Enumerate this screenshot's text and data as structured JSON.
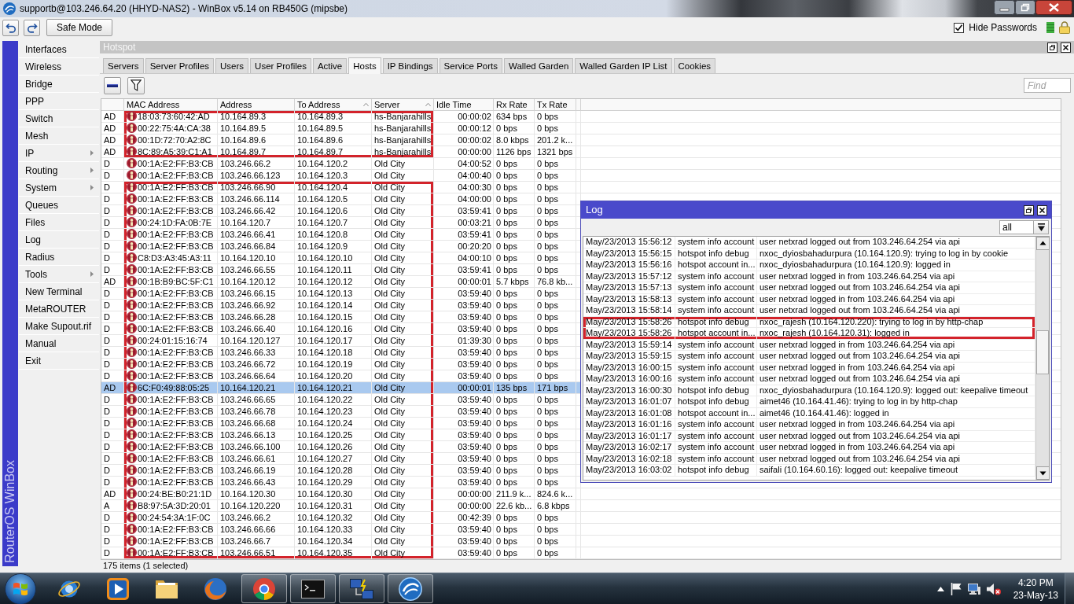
{
  "window": {
    "title": "supportb@103.246.64.20 (HHYD-NAS2) - WinBox v5.14 on RB450G (mipsbe)"
  },
  "toolbar": {
    "safe_mode": {
      "label": "Safe Mode"
    },
    "hide_passwords": {
      "label": "Hide Passwords",
      "checked": true
    }
  },
  "sidebar": {
    "brand": "RouterOS WinBox",
    "items": [
      {
        "label": "Interfaces",
        "submenu": false
      },
      {
        "label": "Wireless",
        "submenu": false
      },
      {
        "label": "Bridge",
        "submenu": false
      },
      {
        "label": "PPP",
        "submenu": false
      },
      {
        "label": "Switch",
        "submenu": false
      },
      {
        "label": "Mesh",
        "submenu": false
      },
      {
        "label": "IP",
        "submenu": true
      },
      {
        "label": "Routing",
        "submenu": true
      },
      {
        "label": "System",
        "submenu": true
      },
      {
        "label": "Queues",
        "submenu": false
      },
      {
        "label": "Files",
        "submenu": false
      },
      {
        "label": "Log",
        "submenu": false
      },
      {
        "label": "Radius",
        "submenu": false
      },
      {
        "label": "Tools",
        "submenu": true
      },
      {
        "label": "New Terminal",
        "submenu": false
      },
      {
        "label": "MetaROUTER",
        "submenu": false
      },
      {
        "label": "Make Supout.rif",
        "submenu": false
      },
      {
        "label": "Manual",
        "submenu": false
      },
      {
        "label": "Exit",
        "submenu": false
      }
    ]
  },
  "hotspot": {
    "title": "Hotspot",
    "tabs": [
      {
        "label": "Servers",
        "selected": false
      },
      {
        "label": "Server Profiles",
        "selected": false
      },
      {
        "label": "Users",
        "selected": false
      },
      {
        "label": "User Profiles",
        "selected": false
      },
      {
        "label": "Active",
        "selected": false
      },
      {
        "label": "Hosts",
        "selected": true
      },
      {
        "label": "IP Bindings",
        "selected": false
      },
      {
        "label": "Service Ports",
        "selected": false
      },
      {
        "label": "Walled Garden",
        "selected": false
      },
      {
        "label": "Walled Garden IP List",
        "selected": false
      },
      {
        "label": "Cookies",
        "selected": false
      }
    ],
    "find": {
      "placeholder": "Find"
    },
    "columns": [
      {
        "label": "MAC Address",
        "sorted": false
      },
      {
        "label": "Address",
        "sorted": false
      },
      {
        "label": "To Address",
        "sorted": true
      },
      {
        "label": "Server",
        "sorted": true
      },
      {
        "label": "Idle Time",
        "sorted": false
      },
      {
        "label": "Rx Rate",
        "sorted": false
      },
      {
        "label": "Tx Rate",
        "sorted": false
      }
    ],
    "rows": [
      {
        "column_1": "AD",
        "mac_address": "18:03:73:60:42:AD",
        "address": "10.164.89.3",
        "to_address": "10.164.89.3",
        "server": "hs-Banjarahills",
        "idle_time": "00:00:02",
        "rx_rate": "634 bps",
        "tx_rate": "0 bps",
        "selected": false,
        "outlined": true
      },
      {
        "column_1": "AD",
        "mac_address": "00:22:75:4A:CA:38",
        "address": "10.164.89.5",
        "to_address": "10.164.89.5",
        "server": "hs-Banjarahills",
        "idle_time": "00:00:12",
        "rx_rate": "0 bps",
        "tx_rate": "0 bps",
        "selected": false,
        "outlined": true
      },
      {
        "column_1": "AD",
        "mac_address": "00:1D:72:70:A2:8C",
        "address": "10.164.89.6",
        "to_address": "10.164.89.6",
        "server": "hs-Banjarahills",
        "idle_time": "00:00:02",
        "rx_rate": "8.0 kbps",
        "tx_rate": "201.2 k...",
        "selected": false,
        "outlined": true
      },
      {
        "column_1": "AD",
        "mac_address": "8C:89:A5:39:C1:A1",
        "address": "10.164.89.7",
        "to_address": "10.164.89.7",
        "server": "hs-Banjarahills",
        "idle_time": "00:00:00",
        "rx_rate": "1126 bps",
        "tx_rate": "1321 bps",
        "selected": false,
        "outlined": true
      },
      {
        "column_1": "D",
        "mac_address": "00:1A:E2:FF:B3:CB",
        "address": "103.246.66.2",
        "to_address": "10.164.120.2",
        "server": "Old City",
        "idle_time": "04:00:52",
        "rx_rate": "0 bps",
        "tx_rate": "0 bps",
        "selected": false,
        "outlined": false
      },
      {
        "column_1": "D",
        "mac_address": "00:1A:E2:FF:B3:CB",
        "address": "103.246.66.123",
        "to_address": "10.164.120.3",
        "server": "Old City",
        "idle_time": "04:00:40",
        "rx_rate": "0 bps",
        "tx_rate": "0 bps",
        "selected": false,
        "outlined": false
      },
      {
        "column_1": "D",
        "mac_address": "00:1A:E2:FF:B3:CB",
        "address": "103.246.66.90",
        "to_address": "10.164.120.4",
        "server": "Old City",
        "idle_time": "04:00:30",
        "rx_rate": "0 bps",
        "tx_rate": "0 bps",
        "selected": false,
        "outlined": true
      },
      {
        "column_1": "D",
        "mac_address": "00:1A:E2:FF:B3:CB",
        "address": "103.246.66.114",
        "to_address": "10.164.120.5",
        "server": "Old City",
        "idle_time": "04:00:00",
        "rx_rate": "0 bps",
        "tx_rate": "0 bps",
        "selected": false,
        "outlined": true
      },
      {
        "column_1": "D",
        "mac_address": "00:1A:E2:FF:B3:CB",
        "address": "103.246.66.42",
        "to_address": "10.164.120.6",
        "server": "Old City",
        "idle_time": "03:59:41",
        "rx_rate": "0 bps",
        "tx_rate": "0 bps",
        "selected": false,
        "outlined": true
      },
      {
        "column_1": "D",
        "mac_address": "00:24:1D:FA:0B:7E",
        "address": "10.164.120.7",
        "to_address": "10.164.120.7",
        "server": "Old City",
        "idle_time": "00:03:21",
        "rx_rate": "0 bps",
        "tx_rate": "0 bps",
        "selected": false,
        "outlined": true
      },
      {
        "column_1": "D",
        "mac_address": "00:1A:E2:FF:B3:CB",
        "address": "103.246.66.41",
        "to_address": "10.164.120.8",
        "server": "Old City",
        "idle_time": "03:59:41",
        "rx_rate": "0 bps",
        "tx_rate": "0 bps",
        "selected": false,
        "outlined": true
      },
      {
        "column_1": "D",
        "mac_address": "00:1A:E2:FF:B3:CB",
        "address": "103.246.66.84",
        "to_address": "10.164.120.9",
        "server": "Old City",
        "idle_time": "00:20:20",
        "rx_rate": "0 bps",
        "tx_rate": "0 bps",
        "selected": false,
        "outlined": true
      },
      {
        "column_1": "D",
        "mac_address": "C8:D3:A3:45:A3:11",
        "address": "10.164.120.10",
        "to_address": "10.164.120.10",
        "server": "Old City",
        "idle_time": "04:00:10",
        "rx_rate": "0 bps",
        "tx_rate": "0 bps",
        "selected": false,
        "outlined": true
      },
      {
        "column_1": "D",
        "mac_address": "00:1A:E2:FF:B3:CB",
        "address": "103.246.66.55",
        "to_address": "10.164.120.11",
        "server": "Old City",
        "idle_time": "03:59:41",
        "rx_rate": "0 bps",
        "tx_rate": "0 bps",
        "selected": false,
        "outlined": true
      },
      {
        "column_1": "AD",
        "mac_address": "00:1B:B9:BC:5F:C1",
        "address": "10.164.120.12",
        "to_address": "10.164.120.12",
        "server": "Old City",
        "idle_time": "00:00:01",
        "rx_rate": "5.7 kbps",
        "tx_rate": "76.8 kb...",
        "selected": false,
        "outlined": true
      },
      {
        "column_1": "D",
        "mac_address": "00:1A:E2:FF:B3:CB",
        "address": "103.246.66.15",
        "to_address": "10.164.120.13",
        "server": "Old City",
        "idle_time": "03:59:40",
        "rx_rate": "0 bps",
        "tx_rate": "0 bps",
        "selected": false,
        "outlined": true
      },
      {
        "column_1": "D",
        "mac_address": "00:1A:E2:FF:B3:CB",
        "address": "103.246.66.92",
        "to_address": "10.164.120.14",
        "server": "Old City",
        "idle_time": "03:59:40",
        "rx_rate": "0 bps",
        "tx_rate": "0 bps",
        "selected": false,
        "outlined": true
      },
      {
        "column_1": "D",
        "mac_address": "00:1A:E2:FF:B3:CB",
        "address": "103.246.66.28",
        "to_address": "10.164.120.15",
        "server": "Old City",
        "idle_time": "03:59:40",
        "rx_rate": "0 bps",
        "tx_rate": "0 bps",
        "selected": false,
        "outlined": true
      },
      {
        "column_1": "D",
        "mac_address": "00:1A:E2:FF:B3:CB",
        "address": "103.246.66.40",
        "to_address": "10.164.120.16",
        "server": "Old City",
        "idle_time": "03:59:40",
        "rx_rate": "0 bps",
        "tx_rate": "0 bps",
        "selected": false,
        "outlined": true
      },
      {
        "column_1": "D",
        "mac_address": "00:24:01:15:16:74",
        "address": "10.164.120.127",
        "to_address": "10.164.120.17",
        "server": "Old City",
        "idle_time": "01:39:30",
        "rx_rate": "0 bps",
        "tx_rate": "0 bps",
        "selected": false,
        "outlined": true
      },
      {
        "column_1": "D",
        "mac_address": "00:1A:E2:FF:B3:CB",
        "address": "103.246.66.33",
        "to_address": "10.164.120.18",
        "server": "Old City",
        "idle_time": "03:59:40",
        "rx_rate": "0 bps",
        "tx_rate": "0 bps",
        "selected": false,
        "outlined": true
      },
      {
        "column_1": "D",
        "mac_address": "00:1A:E2:FF:B3:CB",
        "address": "103.246.66.72",
        "to_address": "10.164.120.19",
        "server": "Old City",
        "idle_time": "03:59:40",
        "rx_rate": "0 bps",
        "tx_rate": "0 bps",
        "selected": false,
        "outlined": true
      },
      {
        "column_1": "D",
        "mac_address": "00:1A:E2:FF:B3:CB",
        "address": "103.246.66.64",
        "to_address": "10.164.120.20",
        "server": "Old City",
        "idle_time": "03:59:40",
        "rx_rate": "0 bps",
        "tx_rate": "0 bps",
        "selected": false,
        "outlined": true
      },
      {
        "column_1": "AD",
        "mac_address": "6C:F0:49:88:05:25",
        "address": "10.164.120.21",
        "to_address": "10.164.120.21",
        "server": "Old City",
        "idle_time": "00:00:01",
        "rx_rate": "135 bps",
        "tx_rate": "171 bps",
        "selected": true,
        "outlined": true
      },
      {
        "column_1": "D",
        "mac_address": "00:1A:E2:FF:B3:CB",
        "address": "103.246.66.65",
        "to_address": "10.164.120.22",
        "server": "Old City",
        "idle_time": "03:59:40",
        "rx_rate": "0 bps",
        "tx_rate": "0 bps",
        "selected": false,
        "outlined": true
      },
      {
        "column_1": "D",
        "mac_address": "00:1A:E2:FF:B3:CB",
        "address": "103.246.66.78",
        "to_address": "10.164.120.23",
        "server": "Old City",
        "idle_time": "03:59:40",
        "rx_rate": "0 bps",
        "tx_rate": "0 bps",
        "selected": false,
        "outlined": true
      },
      {
        "column_1": "D",
        "mac_address": "00:1A:E2:FF:B3:CB",
        "address": "103.246.66.68",
        "to_address": "10.164.120.24",
        "server": "Old City",
        "idle_time": "03:59:40",
        "rx_rate": "0 bps",
        "tx_rate": "0 bps",
        "selected": false,
        "outlined": true
      },
      {
        "column_1": "D",
        "mac_address": "00:1A:E2:FF:B3:CB",
        "address": "103.246.66.13",
        "to_address": "10.164.120.25",
        "server": "Old City",
        "idle_time": "03:59:40",
        "rx_rate": "0 bps",
        "tx_rate": "0 bps",
        "selected": false,
        "outlined": true
      },
      {
        "column_1": "D",
        "mac_address": "00:1A:E2:FF:B3:CB",
        "address": "103.246.66.100",
        "to_address": "10.164.120.26",
        "server": "Old City",
        "idle_time": "03:59:40",
        "rx_rate": "0 bps",
        "tx_rate": "0 bps",
        "selected": false,
        "outlined": true
      },
      {
        "column_1": "D",
        "mac_address": "00:1A:E2:FF:B3:CB",
        "address": "103.246.66.61",
        "to_address": "10.164.120.27",
        "server": "Old City",
        "idle_time": "03:59:40",
        "rx_rate": "0 bps",
        "tx_rate": "0 bps",
        "selected": false,
        "outlined": true
      },
      {
        "column_1": "D",
        "mac_address": "00:1A:E2:FF:B3:CB",
        "address": "103.246.66.19",
        "to_address": "10.164.120.28",
        "server": "Old City",
        "idle_time": "03:59:40",
        "rx_rate": "0 bps",
        "tx_rate": "0 bps",
        "selected": false,
        "outlined": true
      },
      {
        "column_1": "D",
        "mac_address": "00:1A:E2:FF:B3:CB",
        "address": "103.246.66.43",
        "to_address": "10.164.120.29",
        "server": "Old City",
        "idle_time": "03:59:40",
        "rx_rate": "0 bps",
        "tx_rate": "0 bps",
        "selected": false,
        "outlined": true
      },
      {
        "column_1": "AD",
        "mac_address": "00:24:BE:B0:21:1D",
        "address": "10.164.120.30",
        "to_address": "10.164.120.30",
        "server": "Old City",
        "idle_time": "00:00:00",
        "rx_rate": "211.9 k...",
        "tx_rate": "824.6 k...",
        "selected": false,
        "outlined": true
      },
      {
        "column_1": "A",
        "mac_address": "B8:97:5A:3D:20:01",
        "address": "10.164.120.220",
        "to_address": "10.164.120.31",
        "server": "Old City",
        "idle_time": "00:00:00",
        "rx_rate": "22.6 kb...",
        "tx_rate": "6.8 kbps",
        "selected": false,
        "outlined": true
      },
      {
        "column_1": "D",
        "mac_address": "00:24:54:3A:1F:0C",
        "address": "103.246.66.2",
        "to_address": "10.164.120.32",
        "server": "Old City",
        "idle_time": "00:42:39",
        "rx_rate": "0 bps",
        "tx_rate": "0 bps",
        "selected": false,
        "outlined": true
      },
      {
        "column_1": "D",
        "mac_address": "00:1A:E2:FF:B3:CB",
        "address": "103.246.66.66",
        "to_address": "10.164.120.33",
        "server": "Old City",
        "idle_time": "03:59:40",
        "rx_rate": "0 bps",
        "tx_rate": "0 bps",
        "selected": false,
        "outlined": true
      },
      {
        "column_1": "D",
        "mac_address": "00:1A:E2:FF:B3:CB",
        "address": "103.246.66.7",
        "to_address": "10.164.120.34",
        "server": "Old City",
        "idle_time": "03:59:40",
        "rx_rate": "0 bps",
        "tx_rate": "0 bps",
        "selected": false,
        "outlined": true
      },
      {
        "column_1": "D",
        "mac_address": "00:1A:E2:FF:B3:CB",
        "address": "103.246.66.51",
        "to_address": "10.164.120.35",
        "server": "Old City",
        "idle_time": "03:59:40",
        "rx_rate": "0 bps",
        "tx_rate": "0 bps",
        "selected": false,
        "outlined": true
      }
    ],
    "status": "175 items (1 selected)"
  },
  "log": {
    "title": "Log",
    "filter": {
      "value": "all"
    },
    "rows": [
      {
        "time": "May/23/2013 15:56:12",
        "topics": "system info account",
        "message": "user netxrad logged out from 103.246.64.254 via api",
        "outlined": false
      },
      {
        "time": "May/23/2013 15:56:15",
        "topics": "hotspot info debug",
        "message": "nxoc_dyiosbahadurpura (10.164.120.9): trying to log in by cookie",
        "outlined": false
      },
      {
        "time": "May/23/2013 15:56:16",
        "topics": "hotspot account in...",
        "message": "nxoc_dyiosbahadurpura (10.164.120.9): logged in",
        "outlined": false
      },
      {
        "time": "May/23/2013 15:57:12",
        "topics": "system info account",
        "message": "user netxrad logged in from 103.246.64.254 via api",
        "outlined": false
      },
      {
        "time": "May/23/2013 15:57:13",
        "topics": "system info account",
        "message": "user netxrad logged out from 103.246.64.254 via api",
        "outlined": false
      },
      {
        "time": "May/23/2013 15:58:13",
        "topics": "system info account",
        "message": "user netxrad logged in from 103.246.64.254 via api",
        "outlined": false
      },
      {
        "time": "May/23/2013 15:58:14",
        "topics": "system info account",
        "message": "user netxrad logged out from 103.246.64.254 via api",
        "outlined": false
      },
      {
        "time": "May/23/2013 15:58:26",
        "topics": "hotspot info debug",
        "message": "nxoc_rajesh (10.164.120.220): trying to log in by http-chap",
        "outlined": true
      },
      {
        "time": "May/23/2013 15:58:26",
        "topics": "hotspot account in...",
        "message": "nxoc_rajesh (10.164.120.31): logged in",
        "outlined": true
      },
      {
        "time": "May/23/2013 15:59:14",
        "topics": "system info account",
        "message": "user netxrad logged in from 103.246.64.254 via api",
        "outlined": false
      },
      {
        "time": "May/23/2013 15:59:15",
        "topics": "system info account",
        "message": "user netxrad logged out from 103.246.64.254 via api",
        "outlined": false
      },
      {
        "time": "May/23/2013 16:00:15",
        "topics": "system info account",
        "message": "user netxrad logged in from 103.246.64.254 via api",
        "outlined": false
      },
      {
        "time": "May/23/2013 16:00:16",
        "topics": "system info account",
        "message": "user netxrad logged out from 103.246.64.254 via api",
        "outlined": false
      },
      {
        "time": "May/23/2013 16:00:30",
        "topics": "hotspot info debug",
        "message": "nxoc_dyiosbahadurpura (10.164.120.9): logged out: keepalive timeout",
        "outlined": false
      },
      {
        "time": "May/23/2013 16:01:07",
        "topics": "hotspot info debug",
        "message": "aimet46 (10.164.41.46): trying to log in by http-chap",
        "outlined": false
      },
      {
        "time": "May/23/2013 16:01:08",
        "topics": "hotspot account in...",
        "message": "aimet46 (10.164.41.46): logged in",
        "outlined": false
      },
      {
        "time": "May/23/2013 16:01:16",
        "topics": "system info account",
        "message": "user netxrad logged in from 103.246.64.254 via api",
        "outlined": false
      },
      {
        "time": "May/23/2013 16:01:17",
        "topics": "system info account",
        "message": "user netxrad logged out from 103.246.64.254 via api",
        "outlined": false
      },
      {
        "time": "May/23/2013 16:02:17",
        "topics": "system info account",
        "message": "user netxrad logged in from 103.246.64.254 via api",
        "outlined": false
      },
      {
        "time": "May/23/2013 16:02:18",
        "topics": "system info account",
        "message": "user netxrad logged out from 103.246.64.254 via api",
        "outlined": false
      },
      {
        "time": "May/23/2013 16:03:02",
        "topics": "hotspot info debug",
        "message": "saifali (10.164.60.16): logged out: keepalive timeout",
        "outlined": false
      }
    ]
  },
  "taskbar": {
    "apps": [
      {
        "kind": "globeorbit",
        "running": false
      },
      {
        "kind": "playtile",
        "running": false
      },
      {
        "kind": "folder",
        "running": false
      },
      {
        "kind": "globe",
        "running": false
      },
      {
        "kind": "segmented",
        "running": true
      },
      {
        "kind": "terminal",
        "running": true
      },
      {
        "kind": "monitors",
        "running": true
      },
      {
        "kind": "swirl",
        "running": true
      }
    ],
    "clock": {
      "time": "4:20 PM",
      "date": "23-May-13"
    }
  }
}
